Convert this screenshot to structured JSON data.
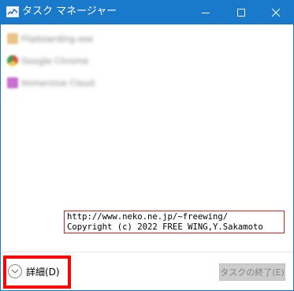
{
  "window": {
    "title": "タスク マネージャー",
    "accent_color": "#1979ca"
  },
  "title_bar": {
    "minimize_icon": "minimize-icon",
    "maximize_icon": "maximize-icon",
    "close_icon": "close-icon"
  },
  "processes": [
    {
      "name": "Flipboarding.exe",
      "icon": "generic-app-icon",
      "icon_color": "#e9c48a"
    },
    {
      "name": "Google Chrome",
      "icon": "chrome-icon",
      "icon_color": "#d9533f"
    },
    {
      "name": "Immersive Cloud",
      "icon": "app-icon",
      "icon_color": "#c86fd0"
    }
  ],
  "credit": {
    "line1": "http://www.neko.ne.jp/~freewing/",
    "line2": "Copyright (c) 2022 FREE WING,Y.Sakamoto",
    "border_color": "#d61f1f"
  },
  "footer": {
    "details_label": "詳細(D)",
    "details_icon": "chevron-down-circle-icon",
    "end_task_label": "タスクの終了(E)",
    "highlight_color": "#ff0000"
  }
}
